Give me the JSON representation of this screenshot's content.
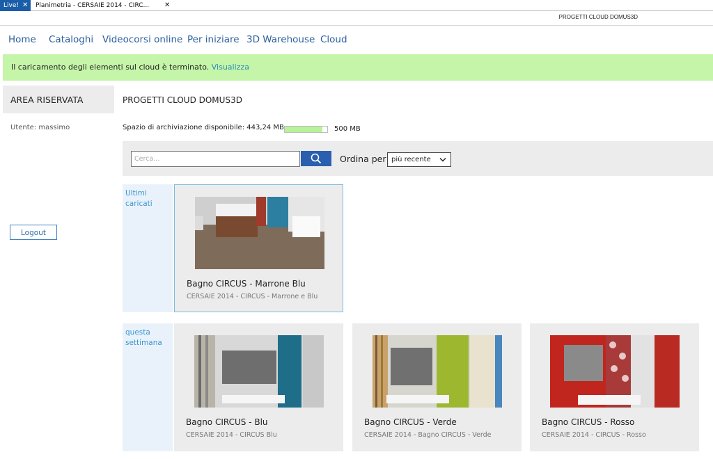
{
  "tabs": [
    {
      "label": "Live!",
      "close": "✕"
    },
    {
      "label": "Planimetria - CERSAIE 2014 - CIRC...",
      "close": "✕"
    }
  ],
  "window_title": "PROGETTI CLOUD DOMUS3D",
  "nav": [
    "Home",
    "Cataloghi",
    "Videocorsi online",
    "Per iniziare",
    "3D Warehouse",
    "Cloud"
  ],
  "notice": {
    "message": "Il caricamento degli elementi sul cloud è terminato.",
    "link": "Visualizza"
  },
  "sidebar": {
    "title": "AREA RISERVATA",
    "user": "Utente: massimo",
    "logout": "Logout"
  },
  "main": {
    "title": "PROGETTI CLOUD DOMUS3D",
    "storage_label": "Spazio di archiviazione disponibile: 443,24 MB",
    "storage_max": "500 MB",
    "storage_fraction": 0.886,
    "search_placeholder": "Cerca...",
    "sort_label": "Ordina per",
    "sort_value": "più recente"
  },
  "groups": [
    {
      "label": "Ultimi caricati",
      "cards": [
        {
          "name": "Bagno CIRCUS - Marrone Blu",
          "sub": "CERSAIE 2014 - CIRCUS - Marrone e Blu"
        }
      ]
    },
    {
      "label": "questa settimana",
      "cards": [
        {
          "name": "Bagno CIRCUS - Blu",
          "sub": "CERSAIE 2014 - CIRCUS Blu"
        },
        {
          "name": "Bagno CIRCUS - Verde",
          "sub": "CERSAIE 2014 - Bagno CIRCUS - Verde"
        },
        {
          "name": "Bagno CIRCUS - Rosso",
          "sub": "CERSAIE 2014 - CIRCUS - Rosso"
        }
      ]
    }
  ],
  "colors": {
    "accent": "#2a5fb0",
    "notice_bg": "#c5f5a9",
    "link": "#2b5f9e",
    "group_bg": "#e9f2fb",
    "group_text": "#3a95d0"
  },
  "icons": {
    "search": "search-icon",
    "chevron": "chevron-down-icon",
    "close": "close-icon"
  }
}
